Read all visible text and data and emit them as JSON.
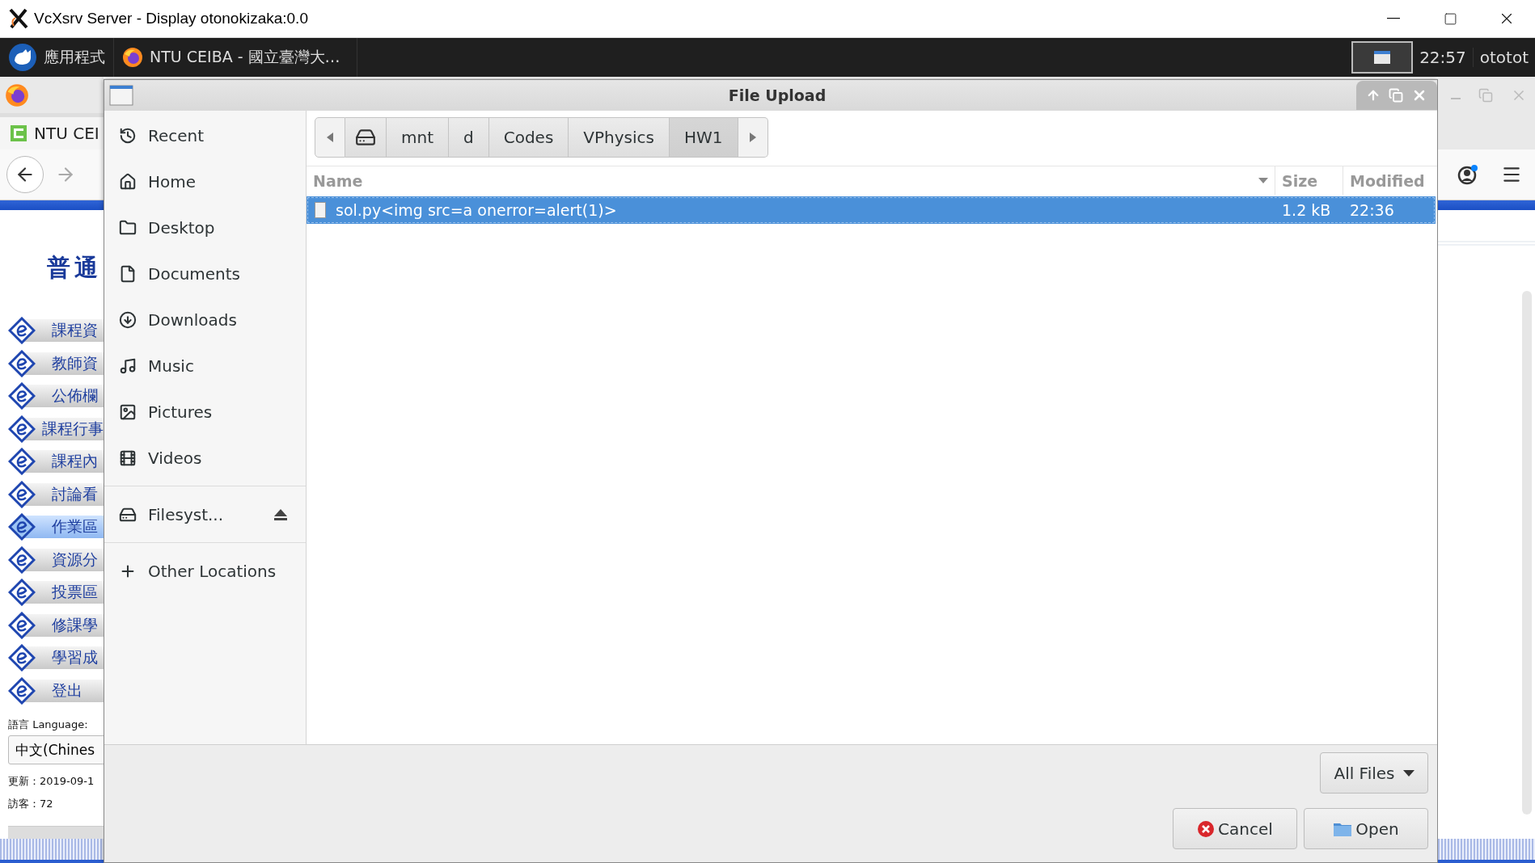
{
  "host_window": {
    "title": "VcXsrv Server - Display otonokizaka:0.0"
  },
  "taskbar": {
    "apps_menu": "應用程式",
    "task": "NTU CEIBA - 國立臺灣大…",
    "clock": "22:57",
    "user": "ototot"
  },
  "browser": {
    "tab": "NTU CEI",
    "page": {
      "heading": "普通",
      "menu": [
        {
          "label": "課程資",
          "selected": false
        },
        {
          "label": "教師資",
          "selected": false
        },
        {
          "label": "公佈欄",
          "selected": false
        },
        {
          "label": "課程行事",
          "selected": false
        },
        {
          "label": "課程內",
          "selected": false
        },
        {
          "label": "討論看",
          "selected": false
        },
        {
          "label": "作業區",
          "selected": true
        },
        {
          "label": "資源分",
          "selected": false
        },
        {
          "label": "投票區",
          "selected": false
        },
        {
          "label": "修課學",
          "selected": false
        },
        {
          "label": "學習成",
          "selected": false
        },
        {
          "label": "登出",
          "selected": false
        }
      ],
      "language_label": "語言 Language:",
      "language_select": "中文(Chines",
      "updated": "更新：2019-09-1",
      "visitors": "訪客：72"
    }
  },
  "dialog": {
    "title": "File Upload",
    "places": [
      {
        "label": "Recent",
        "kind": "place"
      },
      {
        "label": "Home",
        "kind": "place"
      },
      {
        "label": "Desktop",
        "kind": "place"
      },
      {
        "label": "Documents",
        "kind": "place"
      },
      {
        "label": "Downloads",
        "kind": "place"
      },
      {
        "label": "Music",
        "kind": "place"
      },
      {
        "label": "Pictures",
        "kind": "place"
      },
      {
        "label": "Videos",
        "kind": "place"
      },
      {
        "label": "Filesyst...",
        "kind": "device"
      },
      {
        "label": "Other Locations",
        "kind": "action"
      }
    ],
    "path": [
      {
        "label": "mnt",
        "selected": false
      },
      {
        "label": "d",
        "selected": false
      },
      {
        "label": "Codes",
        "selected": false
      },
      {
        "label": "VPhysics",
        "selected": false
      },
      {
        "label": "HW1",
        "selected": true
      }
    ],
    "columns": [
      "Name",
      "Size",
      "Modified"
    ],
    "rows": [
      {
        "name": "sol.py<img src=a onerror=alert(1)>",
        "size": "1.2 kB",
        "modified": "22:36",
        "selected": true
      }
    ],
    "filter": "All Files",
    "buttons": [
      {
        "label": "Cancel",
        "kind": "cancel"
      },
      {
        "label": "Open",
        "kind": "open"
      }
    ]
  }
}
